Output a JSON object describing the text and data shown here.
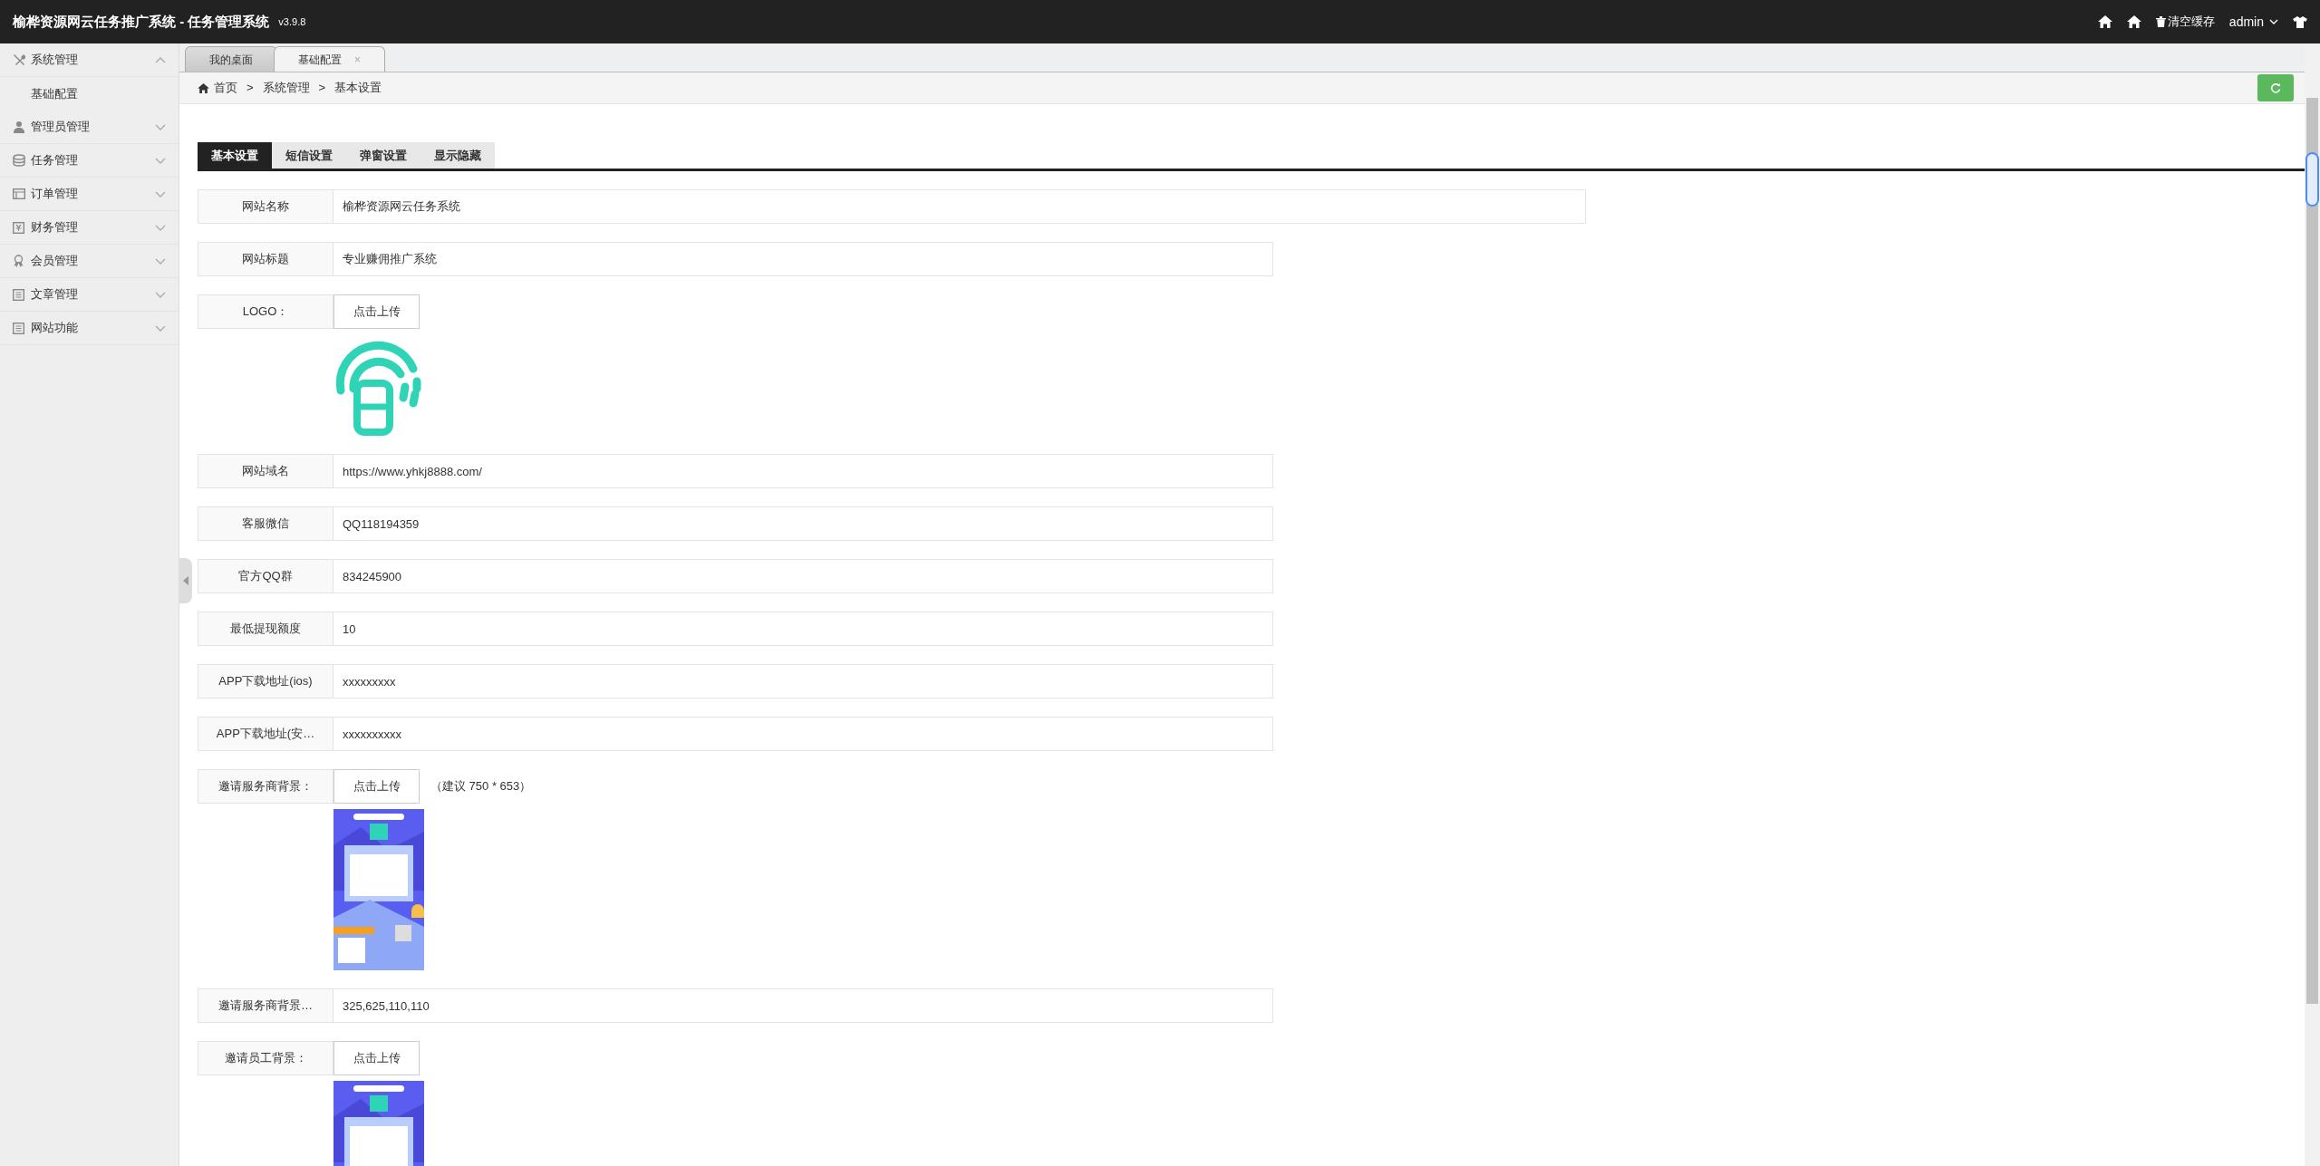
{
  "header": {
    "title": "榆桦资源网云任务推广系统 - 任务管理系统",
    "version": "v3.9.8",
    "clear_cache": "清空缓存",
    "user": "admin"
  },
  "sidebar": [
    {
      "label": "系统管理",
      "expanded": true,
      "children": [
        {
          "label": "基础配置"
        }
      ]
    },
    {
      "label": "管理员管理",
      "expanded": false
    },
    {
      "label": "任务管理",
      "expanded": false
    },
    {
      "label": "订单管理",
      "expanded": false
    },
    {
      "label": "财务管理",
      "expanded": false
    },
    {
      "label": "会员管理",
      "expanded": false
    },
    {
      "label": "文章管理",
      "expanded": false
    },
    {
      "label": "网站功能",
      "expanded": false
    }
  ],
  "page_tabs": [
    {
      "label": "我的桌面",
      "selected": false
    },
    {
      "label": "基础配置",
      "selected": true,
      "close": "×"
    }
  ],
  "breadcrumb": {
    "items": [
      "首页",
      "系统管理",
      "基本设置"
    ],
    "separator": ">"
  },
  "settings_tabs": [
    {
      "label": "基本设置",
      "selected": true
    },
    {
      "label": "短信设置",
      "selected": false
    },
    {
      "label": "弹窗设置",
      "selected": false
    },
    {
      "label": "显示隐藏",
      "selected": false
    }
  ],
  "fields": [
    {
      "kind": "text",
      "label": "网站名称",
      "value": "榆桦资源网云任务系统"
    },
    {
      "kind": "text",
      "label": "网站标题",
      "value": "专业赚佣推广系统"
    },
    {
      "kind": "logo_upload",
      "label": "LOGO：",
      "button": "点击上传"
    },
    {
      "kind": "text",
      "label": "网站域名",
      "value": "https://www.yhkj8888.com/"
    },
    {
      "kind": "text",
      "label": "客服微信",
      "value": "QQ118194359"
    },
    {
      "kind": "text",
      "label": "官方QQ群",
      "value": "834245900"
    },
    {
      "kind": "text",
      "label": "最低提现额度",
      "value": "10"
    },
    {
      "kind": "text",
      "label": "APP下载地址(ios)",
      "value": "xxxxxxxxx"
    },
    {
      "kind": "text",
      "label": "APP下载地址(安…",
      "value": "xxxxxxxxxx"
    },
    {
      "kind": "picture_upload",
      "label": "邀请服务商背景：",
      "button": "点击上传",
      "hint": "（建议 750 * 653）"
    },
    {
      "kind": "text",
      "label": "邀请服务商背景…",
      "value": "325,625,110,110"
    },
    {
      "kind": "picture_upload",
      "label": "邀请员工背景：",
      "button": "点击上传"
    }
  ]
}
